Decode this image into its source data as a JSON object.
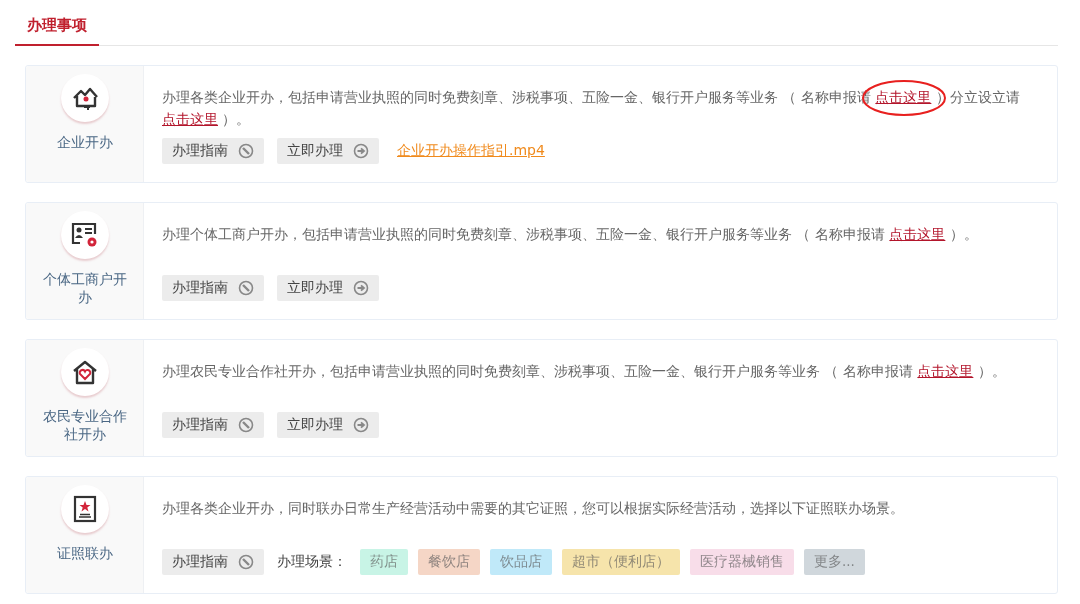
{
  "tabs": [
    {
      "label": "办理事项",
      "selected": true
    }
  ],
  "services": [
    {
      "title": "企业开办",
      "description": [
        {
          "text": "办理各类企业开办，包括申请营业执照的同时免费刻章、涉税事项、五险一金、银行开户服务等业务 （ 名称申报请 "
        },
        {
          "link": "点击这里",
          "circled": true
        },
        {
          "text": " ）分立设立请 "
        },
        {
          "link": "点击这里",
          "circled": false
        },
        {
          "text": " ）。"
        }
      ],
      "actions": [
        {
          "kind": "guide",
          "label": "办理指南"
        },
        {
          "kind": "go",
          "label": "立即办理"
        },
        {
          "kind": "video",
          "label": "企业开办操作指引.mp4"
        }
      ]
    },
    {
      "title": "个体工商户开办",
      "description": [
        {
          "text": "办理个体工商户开办，包括申请营业执照的同时免费刻章、涉税事项、五险一金、银行开户服务等业务 （ 名称申报请 "
        },
        {
          "link": "点击这里",
          "circled": false
        },
        {
          "text": " ）。"
        }
      ],
      "actions": [
        {
          "kind": "guide",
          "label": "办理指南"
        },
        {
          "kind": "go",
          "label": "立即办理"
        }
      ]
    },
    {
      "title": "农民专业合作社开办",
      "description": [
        {
          "text": "办理农民专业合作社开办，包括申请营业执照的同时免费刻章、涉税事项、五险一金、银行开户服务等业务 （ 名称申报请 "
        },
        {
          "link": "点击这里",
          "circled": false
        },
        {
          "text": " ）。"
        }
      ],
      "actions": [
        {
          "kind": "guide",
          "label": "办理指南"
        },
        {
          "kind": "go",
          "label": "立即办理"
        }
      ]
    },
    {
      "title": "证照联办",
      "description": [
        {
          "text": "办理各类企业开办，同时联办日常生产经营活动中需要的其它证照，您可以根据实际经营活动，选择以下证照联办场景。"
        }
      ],
      "actions": [
        {
          "kind": "guide",
          "label": "办理指南"
        },
        {
          "kind": "scenes",
          "label": "办理场景：",
          "tags": [
            {
              "label": "药店",
              "color": "#c8f4e6"
            },
            {
              "label": "餐饮店",
              "color": "#f5d6c6"
            },
            {
              "label": "饮品店",
              "color": "#c0e9f9"
            },
            {
              "label": "超市（便利店）",
              "color": "#f6e4ab"
            },
            {
              "label": "医疗器械销售",
              "color": "#f8dde9"
            },
            {
              "label": "更多...",
              "color": "#d0d7dc"
            }
          ]
        }
      ]
    }
  ]
}
